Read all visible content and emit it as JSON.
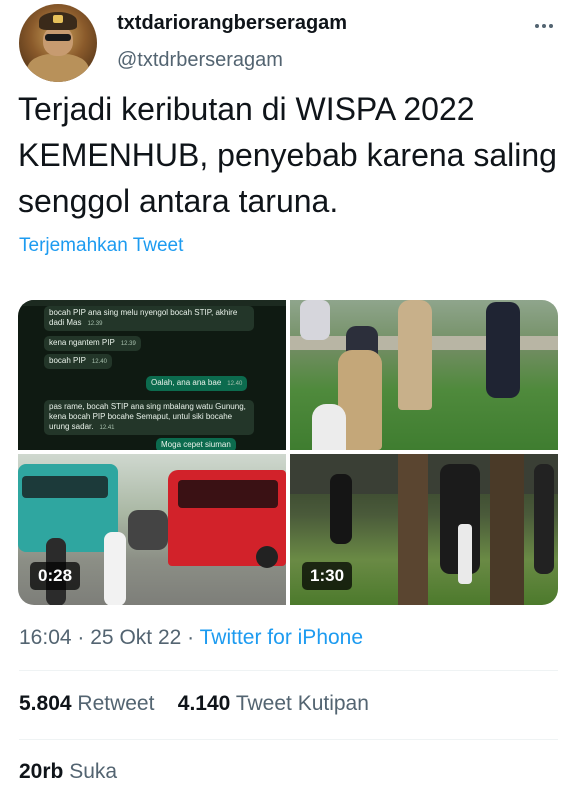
{
  "author": {
    "display_name": "txtdariorangberseragam",
    "username": "@txtdrberseragam",
    "more_icon": "more-horizontal-icon"
  },
  "tweet": {
    "text": "Terjadi keributan di WISPA 2022 KEMENHUB, penyebab karena saling senggol antara taruna.",
    "translate_label": "Terjemahkan Tweet"
  },
  "media": {
    "chat": [
      {
        "text": "bocah PIP ana sing melu nyengol bocah STIP, akhire dadi Mas",
        "time": "12.39",
        "dir": "in"
      },
      {
        "text": "kena ngantem PIP",
        "time": "12.39",
        "dir": "in"
      },
      {
        "text": "bocah PIP",
        "time": "12.40",
        "dir": "in"
      },
      {
        "text": "Oalah, ana ana bae",
        "time": "12.40",
        "dir": "out"
      },
      {
        "text": "pas rame, bocah STIP ana sing mbalang watu Gunung, kena bocah PIP bocahe Semaput, untul siki bocahe urung sadar.",
        "time": "12.41",
        "dir": "in"
      },
      {
        "text": "Moga cepet siuman",
        "time": "",
        "dir": "out"
      }
    ],
    "video1_duration": "0:28",
    "video2_duration": "1:30"
  },
  "meta": {
    "time": "16:04",
    "separator": "·",
    "date": "25 Okt 22",
    "source": "Twitter for iPhone"
  },
  "stats": {
    "retweets_count": "5.804",
    "retweets_label": "Retweet",
    "quotes_count": "4.140",
    "quotes_label": "Tweet Kutipan",
    "likes_count": "20rb",
    "likes_label": "Suka"
  },
  "colors": {
    "accent": "#1d9bf0",
    "secondary_text": "#536471",
    "primary_text": "#0f1419"
  }
}
